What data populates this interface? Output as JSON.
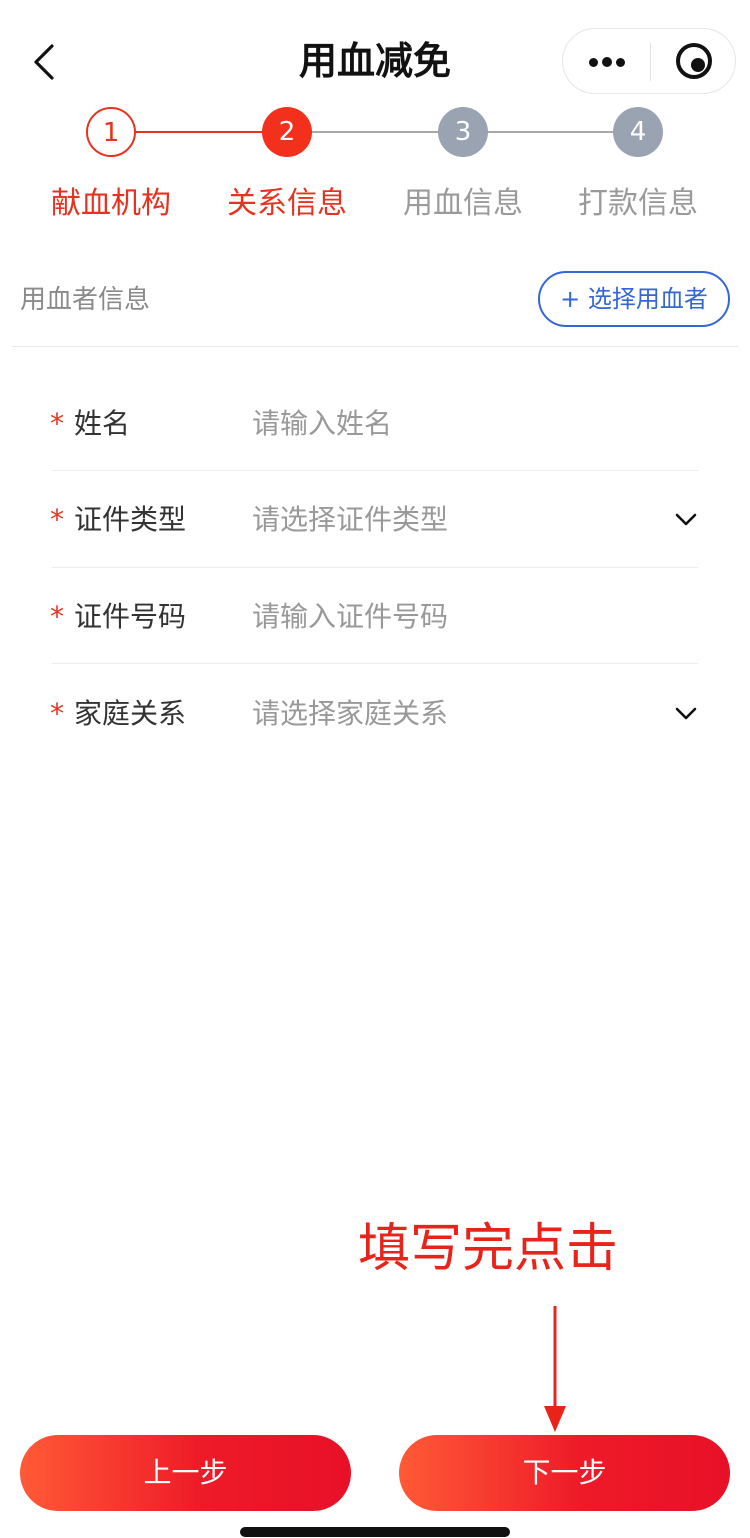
{
  "header": {
    "title": "用血减免"
  },
  "stepper": {
    "steps": [
      {
        "number": "1",
        "label": "献血机构",
        "state": "done"
      },
      {
        "number": "2",
        "label": "关系信息",
        "state": "current"
      },
      {
        "number": "3",
        "label": "用血信息",
        "state": "pending"
      },
      {
        "number": "4",
        "label": "打款信息",
        "state": "pending"
      }
    ]
  },
  "section": {
    "title": "用血者信息",
    "select_button": "+ 选择用血者"
  },
  "form": {
    "required_mark": "*",
    "fields": [
      {
        "label": "姓名",
        "placeholder": "请输入姓名",
        "type": "input"
      },
      {
        "label": "证件类型",
        "placeholder": "请选择证件类型",
        "type": "select"
      },
      {
        "label": "证件号码",
        "placeholder": "请输入证件号码",
        "type": "input"
      },
      {
        "label": "家庭关系",
        "placeholder": "请选择家庭关系",
        "type": "select"
      }
    ]
  },
  "annotation": {
    "text": "填写完点击"
  },
  "footer": {
    "prev_label": "上一步",
    "next_label": "下一步"
  },
  "icons": {
    "back": "chevron-left-icon",
    "more": "more-dots-icon",
    "close": "target-circle-icon",
    "dropdown": "chevron-down-icon",
    "annotation_arrow": "arrow-down-icon"
  },
  "colors": {
    "accent_red": "#e8321f",
    "step_pending": "#9aa3b2",
    "link_blue": "#3566d8",
    "button_gradient_start": "#ff5a36",
    "button_gradient_end": "#e81027"
  }
}
